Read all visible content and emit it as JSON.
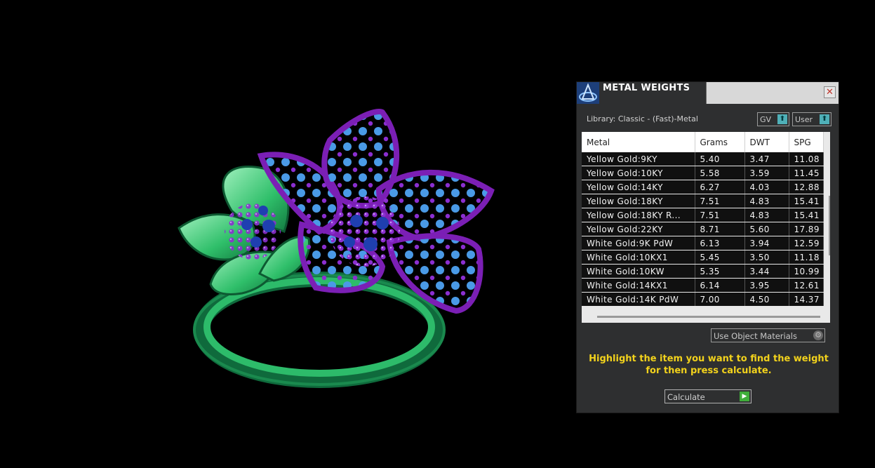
{
  "panel": {
    "title": "METAL WEIGHTS",
    "close_glyph": "✕",
    "library_label": "Library: Classic - (Fast)-Metal",
    "gv_select": {
      "value": "GV",
      "arrow": "⬆"
    },
    "user_select": {
      "value": "User",
      "arrow": "⬆"
    },
    "table": {
      "columns": [
        "Metal",
        "Grams",
        "DWT",
        "SPG"
      ],
      "rows": [
        [
          "Yellow Gold:9KY",
          "5.40",
          "3.47",
          "11.08"
        ],
        [
          "Yellow Gold:10KY",
          "5.58",
          "3.59",
          "11.45"
        ],
        [
          "Yellow Gold:14KY",
          "6.27",
          "4.03",
          "12.88"
        ],
        [
          "Yellow Gold:18KY",
          "7.51",
          "4.83",
          "15.41"
        ],
        [
          "Yellow Gold:18KY R...",
          "7.51",
          "4.83",
          "15.41"
        ],
        [
          "Yellow Gold:22KY",
          "8.71",
          "5.60",
          "17.89"
        ],
        [
          "White Gold:9K PdW",
          "6.13",
          "3.94",
          "12.59"
        ],
        [
          "White Gold:10KX1",
          "5.45",
          "3.50",
          "11.18"
        ],
        [
          "White Gold:10KW",
          "5.35",
          "3.44",
          "10.99"
        ],
        [
          "White Gold:14KX1",
          "6.14",
          "3.95",
          "12.61"
        ],
        [
          "White Gold:14K PdW",
          "7.00",
          "4.50",
          "14.37"
        ]
      ]
    },
    "material_select": {
      "value": "Use Object Materials",
      "icon": "gear-icon"
    },
    "hint_line1": "Highlight the item you want to find the weight",
    "hint_line2": "for then press calculate.",
    "calculate_button": {
      "label": "Calculate",
      "icon": "play-icon",
      "glyph": "▶"
    }
  },
  "colors": {
    "panel_bg": "#2e2f30",
    "hint_text": "#f2d21c",
    "flower_purple": "#7b1fb5",
    "leaf_green": "#2fbf6a",
    "stone_blue": "#3b86d8"
  }
}
